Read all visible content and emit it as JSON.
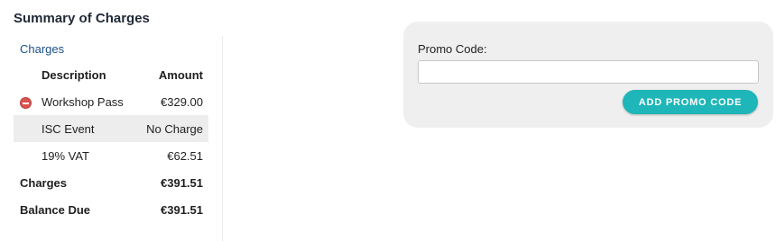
{
  "summary": {
    "title": "Summary of Charges",
    "charges_link": "Charges",
    "headers": {
      "description": "Description",
      "amount": "Amount"
    },
    "items": [
      {
        "description": "Workshop Pass",
        "amount": "€329.00",
        "removable": true
      },
      {
        "description": "ISC Event",
        "amount": "No Charge",
        "removable": false
      },
      {
        "description": "19% VAT",
        "amount": "€62.51",
        "removable": false
      }
    ],
    "totals": [
      {
        "label": "Charges",
        "amount": "€391.51"
      },
      {
        "label": "Balance Due",
        "amount": "€391.51"
      }
    ]
  },
  "promo": {
    "label": "Promo Code:",
    "input_value": "",
    "button_label": "ADD PROMO CODE"
  },
  "colors": {
    "accent": "#1eb6b8",
    "link": "#1c4f8a",
    "remove": "#d9534f",
    "panel_bg": "#efefef",
    "row_highlight": "#ededed"
  },
  "icons": {
    "remove_item": "minus-circle-icon"
  }
}
